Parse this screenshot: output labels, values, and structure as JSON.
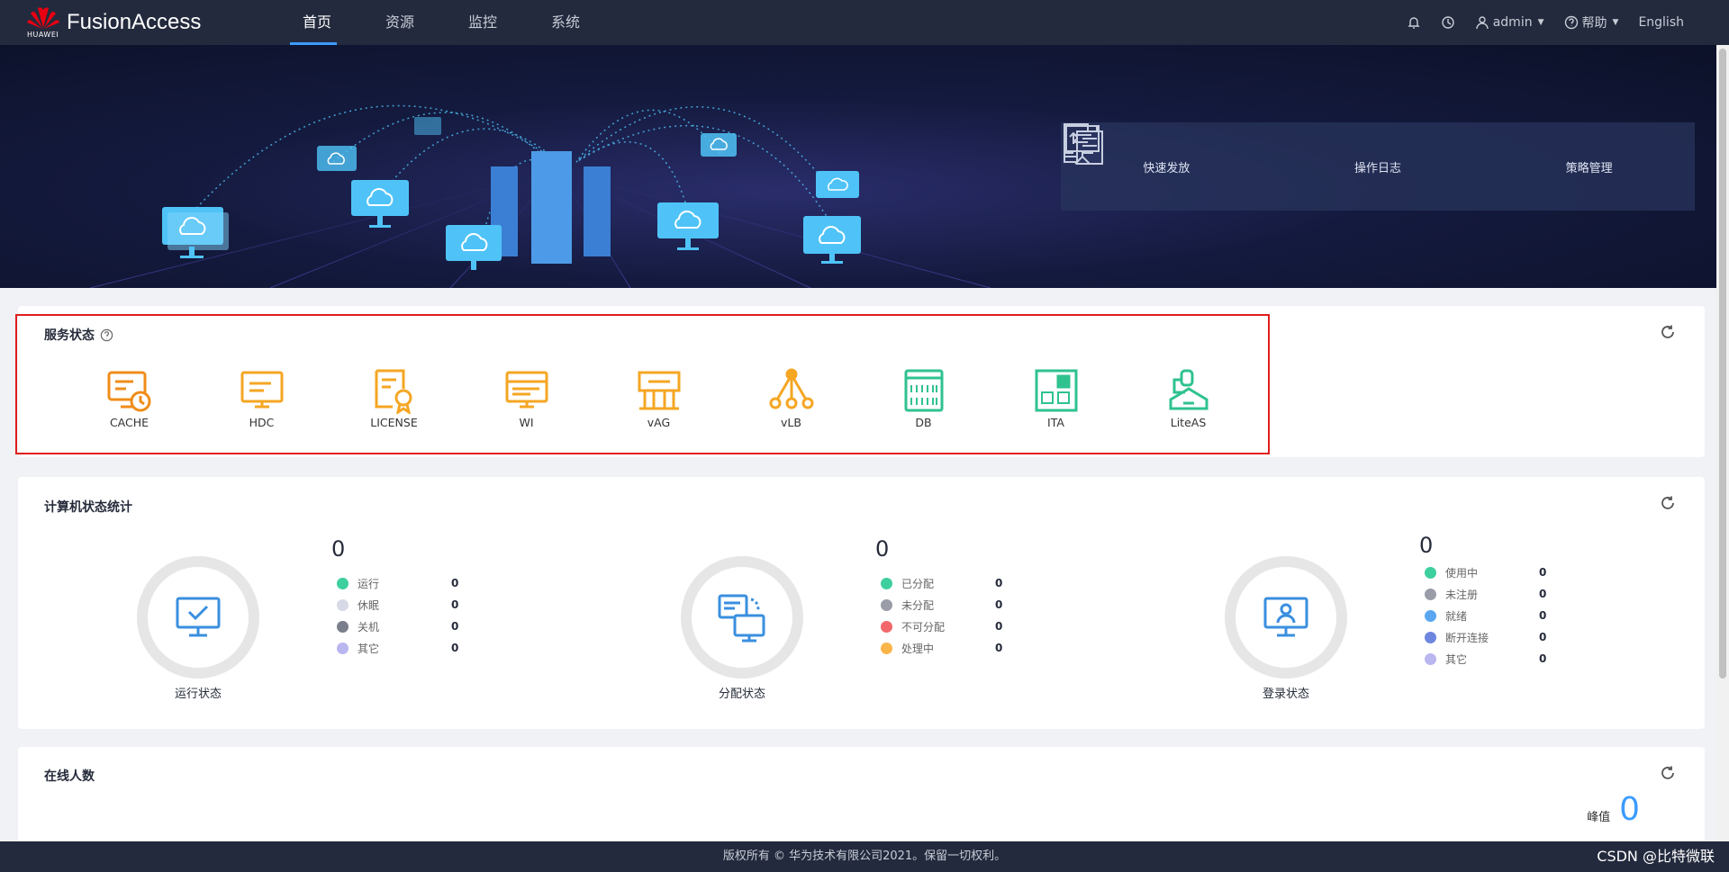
{
  "app": {
    "brand_small": "HUAWEI",
    "brand_name": "FusionAccess",
    "logo_color": "#e60012"
  },
  "nav": {
    "items": [
      {
        "label": "首页",
        "active": true
      },
      {
        "label": "资源",
        "active": false
      },
      {
        "label": "监控",
        "active": false
      },
      {
        "label": "系统",
        "active": false
      }
    ]
  },
  "topright": {
    "user": "admin",
    "help": "帮助",
    "language": "English",
    "icons": [
      "bell-icon",
      "clock-icon",
      "user-icon",
      "help-icon"
    ]
  },
  "quick_actions": [
    {
      "label": "快速发放",
      "icon": "upload-icon"
    },
    {
      "label": "操作日志",
      "icon": "document-log-icon"
    },
    {
      "label": "策略管理",
      "icon": "presentation-board-icon"
    }
  ],
  "service_status": {
    "title": "服务状态",
    "services": [
      {
        "label": "CACHE",
        "color": "#f08c1a"
      },
      {
        "label": "HDC",
        "color": "#f5a623"
      },
      {
        "label": "LICENSE",
        "color": "#f5a623"
      },
      {
        "label": "WI",
        "color": "#f5a623"
      },
      {
        "label": "vAG",
        "color": "#f5a623"
      },
      {
        "label": "vLB",
        "color": "#f5a623"
      },
      {
        "label": "DB",
        "color": "#2fc28f"
      },
      {
        "label": "ITA",
        "color": "#2fc28f"
      },
      {
        "label": "LiteAS",
        "color": "#2fc28f"
      }
    ]
  },
  "computer_stats": {
    "title": "计算机状态统计",
    "blocks": [
      {
        "name": "运行状态",
        "total": "0",
        "legend": [
          {
            "label": "运行",
            "value": "0",
            "color": "#3ecf9e"
          },
          {
            "label": "休眠",
            "value": "0",
            "color": "#d6dae6"
          },
          {
            "label": "关机",
            "value": "0",
            "color": "#7a7e8c"
          },
          {
            "label": "其它",
            "value": "0",
            "color": "#b9b6f0"
          }
        ]
      },
      {
        "name": "分配状态",
        "total": "0",
        "legend": [
          {
            "label": "已分配",
            "value": "0",
            "color": "#3ecf9e"
          },
          {
            "label": "未分配",
            "value": "0",
            "color": "#9a9ca8"
          },
          {
            "label": "不可分配",
            "value": "0",
            "color": "#f2676b"
          },
          {
            "label": "处理中",
            "value": "0",
            "color": "#f9b54a"
          }
        ]
      },
      {
        "name": "登录状态",
        "total": "0",
        "legend": [
          {
            "label": "使用中",
            "value": "0",
            "color": "#3ecf9e"
          },
          {
            "label": "未注册",
            "value": "0",
            "color": "#9a9ca8"
          },
          {
            "label": "就绪",
            "value": "0",
            "color": "#5aa6f0"
          },
          {
            "label": "断开连接",
            "value": "0",
            "color": "#6e86e0"
          },
          {
            "label": "其它",
            "value": "0",
            "color": "#b9b6f0"
          }
        ]
      }
    ]
  },
  "online": {
    "title": "在线人数",
    "peak_label": "峰值",
    "peak_value": "0"
  },
  "footer": {
    "copyright": "版权所有 © 华为技术有限公司2021。保留一切权利。",
    "watermark": "CSDN @比特微联"
  }
}
